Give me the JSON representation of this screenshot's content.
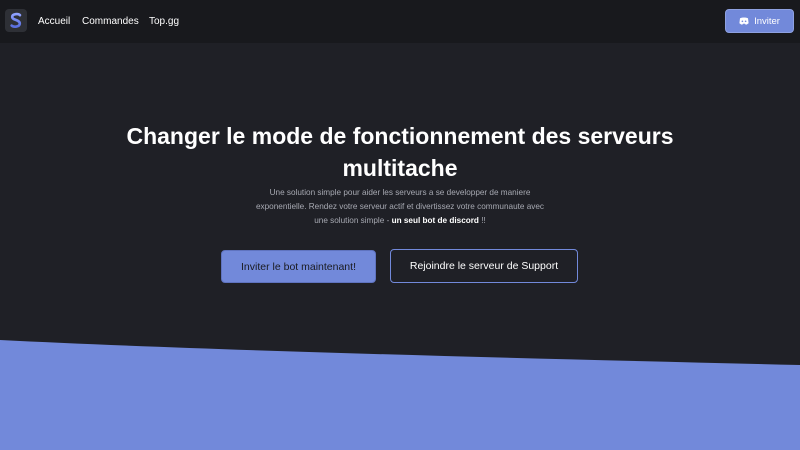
{
  "nav": {
    "logo_letter": "S",
    "links": [
      "Accueil",
      "Commandes",
      "Top.gg"
    ],
    "invite_label": "Inviter"
  },
  "hero": {
    "title": "Changer le mode de fonctionnement des serveurs multitache",
    "description": "Une solution simple pour aider les serveurs a se developper de maniere exponentielle. Rendez votre serveur actif et divertissez votre communaute avec une solution simple - ",
    "description_bold": "un seul bot de discord",
    "description_end": " !!",
    "primary_button": "Inviter le bot maintenant!",
    "secondary_button": "Rejoindre le serveur de Support"
  },
  "colors": {
    "background": "#1f2026",
    "navbar": "#18191d",
    "accent": "#7289da"
  },
  "icons": {
    "logo": "bot-logo-icon",
    "invite": "discord-icon"
  }
}
